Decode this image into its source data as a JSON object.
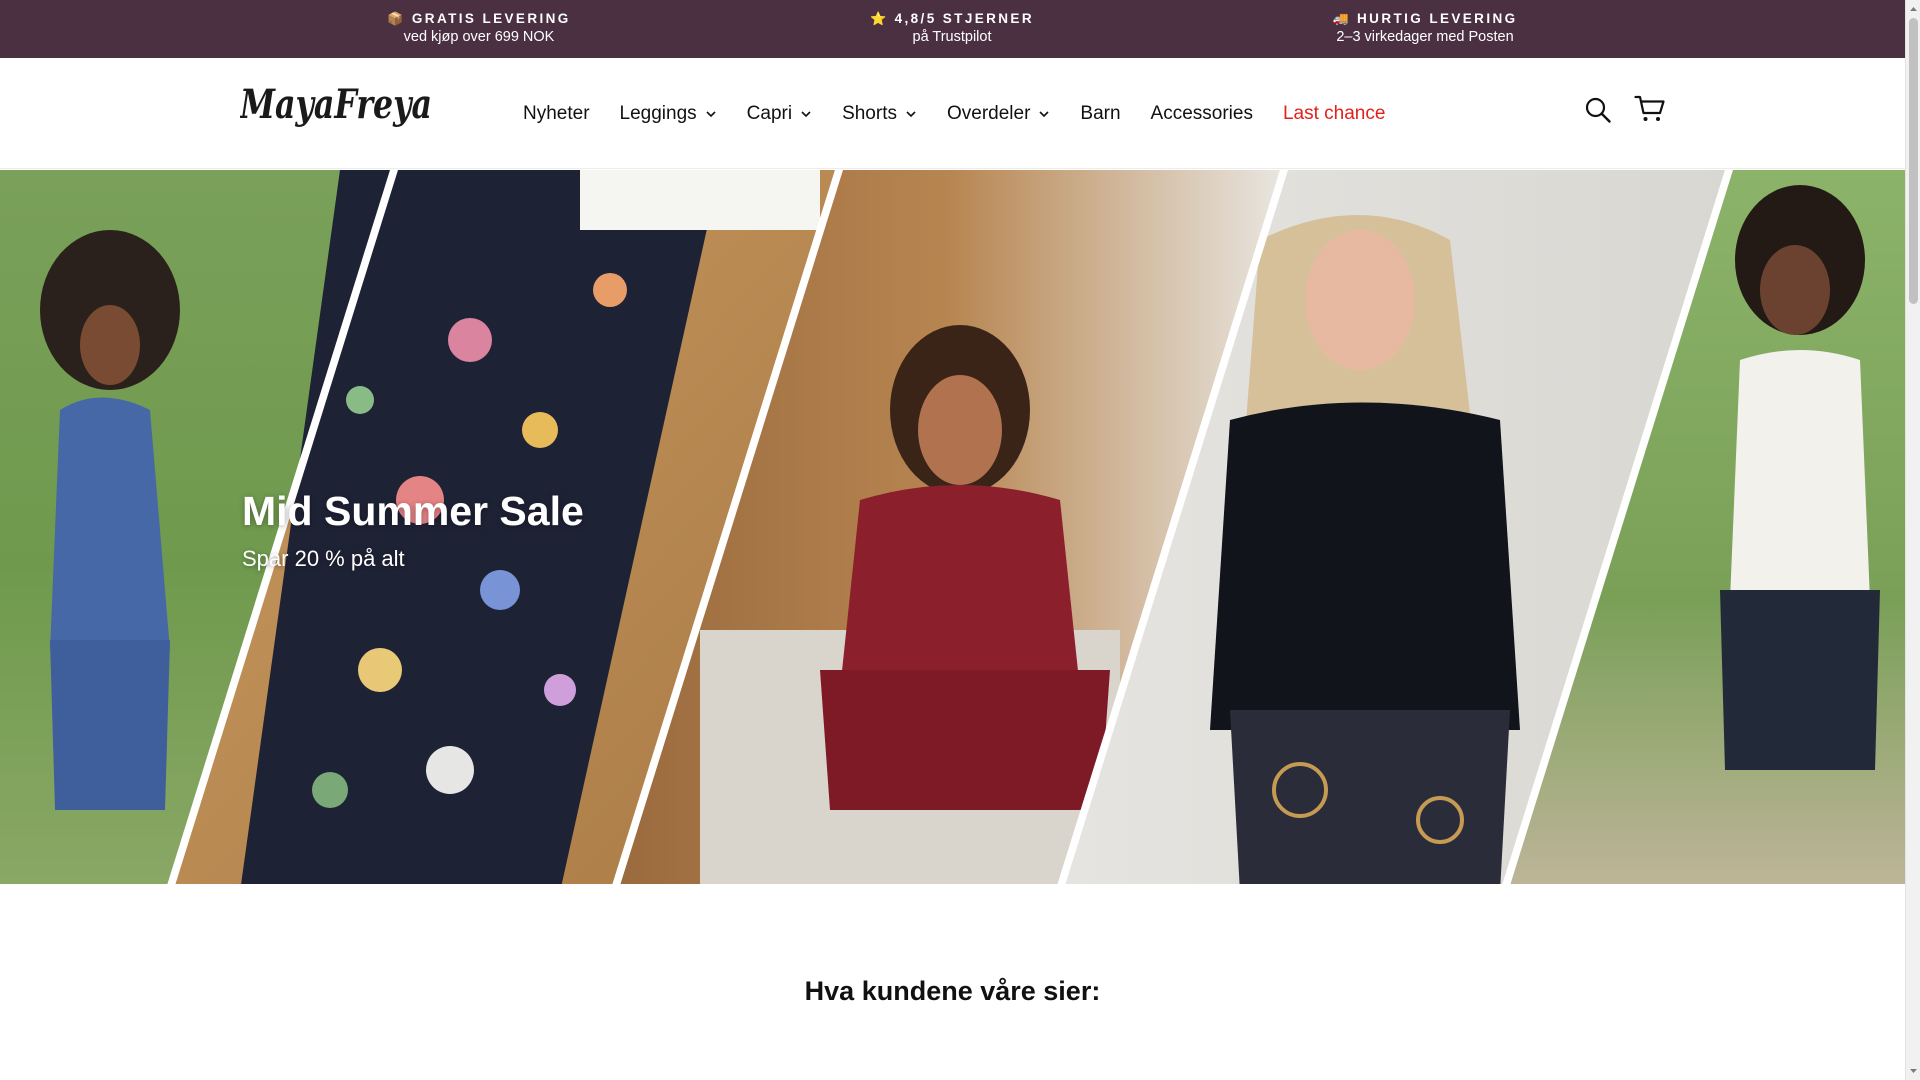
{
  "announcement": {
    "items": [
      {
        "icon": "package-icon",
        "emoji": "📦",
        "title": "GRATIS LEVERING",
        "subtitle": "ved kjøp over 699 NOK"
      },
      {
        "icon": "star-icon",
        "emoji": "⭐",
        "title": "4,8/5 STJERNER",
        "subtitle": "på Trustpilot"
      },
      {
        "icon": "truck-icon",
        "emoji": "🚚",
        "title": "HURTIG LEVERING",
        "subtitle": "2–3 virkedager med Posten"
      }
    ],
    "background_color": "#4b3042"
  },
  "header": {
    "logo_text": "MayaFreya",
    "nav": [
      {
        "label": "Nyheter",
        "has_dropdown": false
      },
      {
        "label": "Leggings",
        "has_dropdown": true
      },
      {
        "label": "Capri",
        "has_dropdown": true
      },
      {
        "label": "Shorts",
        "has_dropdown": true
      },
      {
        "label": "Overdeler",
        "has_dropdown": true
      },
      {
        "label": "Barn",
        "has_dropdown": false
      },
      {
        "label": "Accessories",
        "has_dropdown": false
      },
      {
        "label": "Last chance",
        "has_dropdown": false,
        "highlight": true
      }
    ],
    "highlight_color": "#e2211c",
    "icons": [
      "search-icon",
      "cart-icon"
    ]
  },
  "hero": {
    "title": "Mid Summer Sale",
    "subtitle": "Spar 20 % på alt"
  },
  "reviews": {
    "title": "Hva kundene våre sier:"
  }
}
